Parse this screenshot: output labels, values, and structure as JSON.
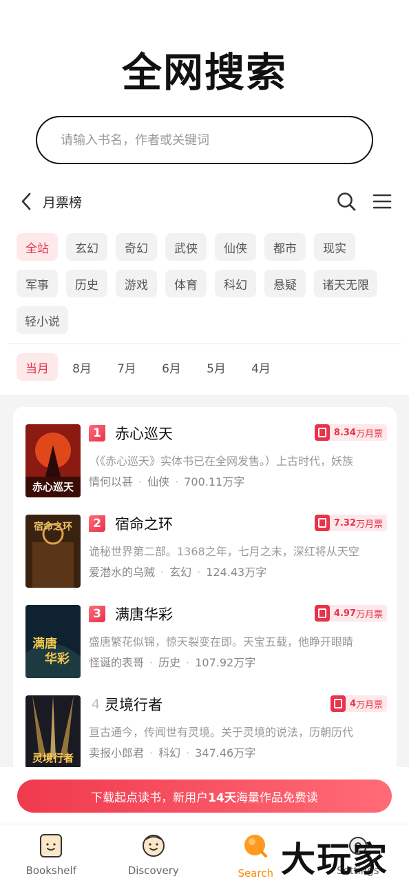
{
  "header": {
    "logo_text": "全网搜索"
  },
  "search": {
    "placeholder": "请输入书名，作者或关键词"
  },
  "nav": {
    "title": "月票榜"
  },
  "categories": [
    "全站",
    "玄幻",
    "奇幻",
    "武侠",
    "仙侠",
    "都市",
    "现实",
    "军事",
    "历史",
    "游戏",
    "体育",
    "科幻",
    "悬疑",
    "诸天无限",
    "轻小说"
  ],
  "months": [
    "当月",
    "8月",
    "7月",
    "6月",
    "5月",
    "4月"
  ],
  "books": [
    {
      "rank": "1",
      "title": "赤心巡天",
      "votes_num": "8.34",
      "votes_unit": "万月票",
      "desc": "（《赤心巡天》实体书已在全网发售。）上古时代，妖族",
      "author": "情何以甚",
      "genre": "仙侠",
      "words": "700.11万字"
    },
    {
      "rank": "2",
      "title": "宿命之环",
      "votes_num": "7.32",
      "votes_unit": "万月票",
      "desc": "诡秘世界第二部。1368之年，七月之末，深红将从天空",
      "author": "爱潜水的乌贼",
      "genre": "玄幻",
      "words": "124.43万字"
    },
    {
      "rank": "3",
      "title": "满唐华彩",
      "votes_num": "4.97",
      "votes_unit": "万月票",
      "desc": "盛唐繁花似锦，惊天裂变在即。天宝五载，他睁开眼睛",
      "author": "怪诞的表哥",
      "genre": "历史",
      "words": "107.92万字"
    },
    {
      "rank": "4",
      "title": "灵境行者",
      "votes_num": "4",
      "votes_unit": "万月票",
      "desc": "亘古通今，传闻世有灵境。关于灵境的说法，历朝历代",
      "author": "卖报小郎君",
      "genre": "科幻",
      "words": "347.46万字"
    }
  ],
  "banner": {
    "prefix": "下载起点读书，新用户",
    "highlight": "14天",
    "suffix": "海量作品免费读"
  },
  "tabs": [
    "Bookshelf",
    "Discovery",
    "Search",
    "Settings"
  ],
  "watermark": "大玩家",
  "colors": {
    "accent": "#e8334a",
    "tab_active": "#ff8a00"
  }
}
